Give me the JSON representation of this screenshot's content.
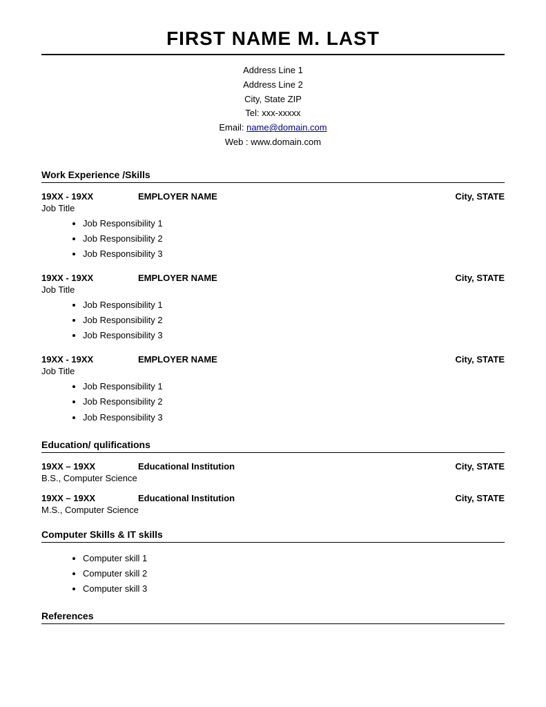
{
  "header": {
    "name": "FIRST NAME M. LAST"
  },
  "contact": {
    "address1": "Address Line 1",
    "address2": "Address Line 2",
    "cityStateZip": "City, State ZIP",
    "tel": "Tel: xxx-xxxxx",
    "emailLabel": "Email: ",
    "emailLink": "name@domain.com",
    "emailHref": "mailto:name@domain.com",
    "web": "Web : www.domain.com"
  },
  "sections": {
    "workExperience": {
      "heading": "Work Experience /Skills",
      "jobs": [
        {
          "dates": "19XX - 19XX",
          "employer": "EMPLOYER NAME",
          "city": "City, STATE",
          "title": "Job Title",
          "responsibilities": [
            "Job Responsibility 1",
            "Job Responsibility 2",
            "Job Responsibility 3"
          ]
        },
        {
          "dates": "19XX - 19XX",
          "employer": "EMPLOYER NAME",
          "city": "City, STATE",
          "title": "Job Title",
          "responsibilities": [
            "Job Responsibility 1",
            "Job Responsibility 2",
            "Job Responsibility 3"
          ]
        },
        {
          "dates": "19XX - 19XX",
          "employer": "EMPLOYER NAME",
          "city": "City, STATE",
          "title": "Job Title",
          "responsibilities": [
            "Job Responsibility 1",
            "Job Responsibility 2",
            "Job Responsibility 3"
          ]
        }
      ]
    },
    "education": {
      "heading": "Education/ qulifications",
      "entries": [
        {
          "dates": "19XX – 19XX",
          "institution": "Educational Institution",
          "city": "City, STATE",
          "degree": "B.S., Computer Science"
        },
        {
          "dates": "19XX – 19XX",
          "institution": "Educational Institution",
          "city": "City, STATE",
          "degree": "M.S., Computer Science"
        }
      ]
    },
    "computerSkills": {
      "heading": "Computer Skills & IT skills",
      "skills": [
        "Computer skill 1",
        "Computer skill 2",
        "Computer skill 3"
      ]
    },
    "references": {
      "heading": "References"
    }
  }
}
